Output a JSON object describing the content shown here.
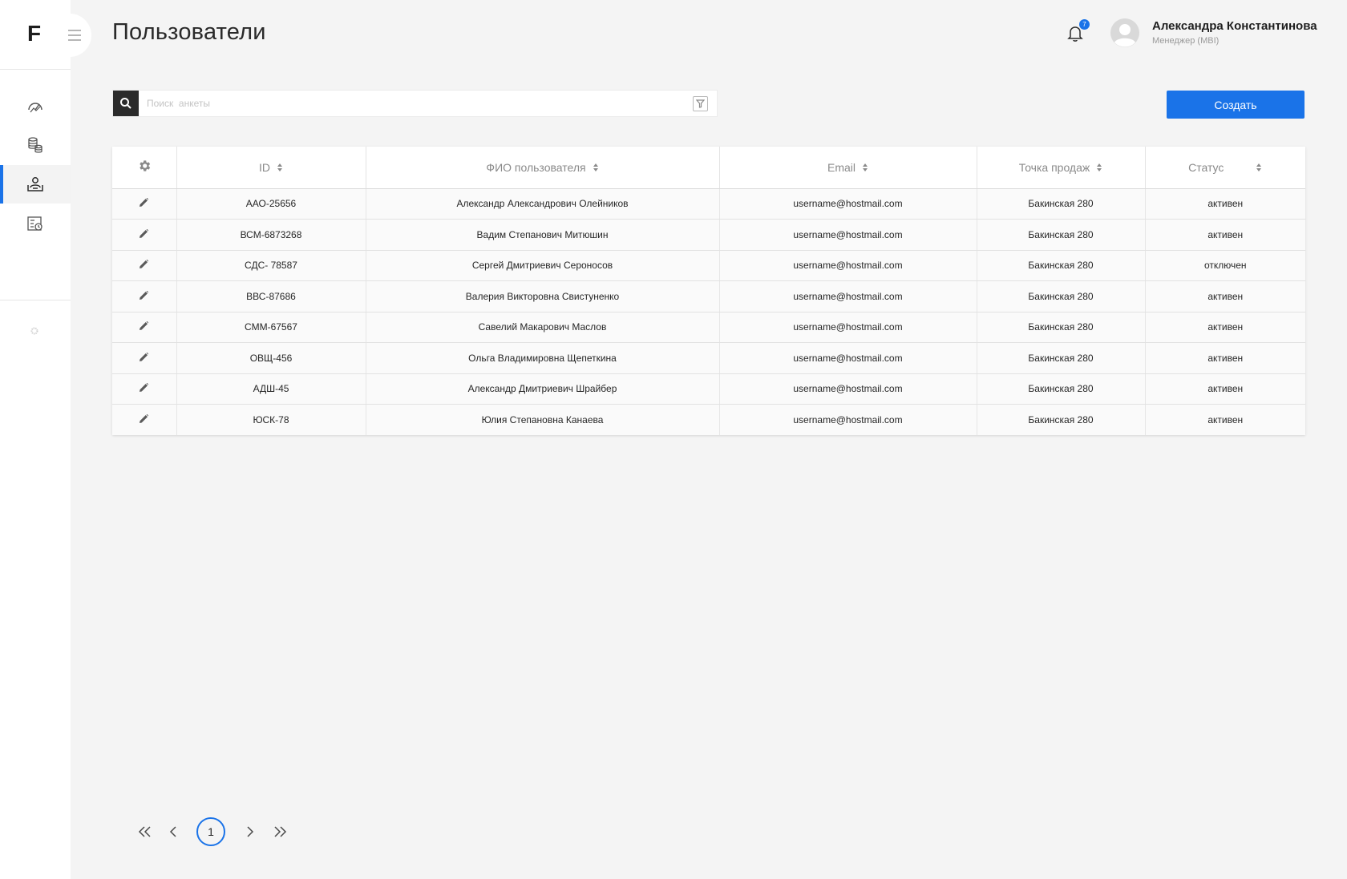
{
  "app": {
    "logo": "F"
  },
  "header": {
    "title": "Пользователи",
    "notifications_count": "7",
    "user_name": "Александра Константинова",
    "user_role": "Менеджер (МВI)"
  },
  "search": {
    "placeholder": "Поиск  анкеты"
  },
  "toolbar": {
    "create_label": "Создать"
  },
  "table": {
    "columns": [
      "ID",
      "ФИО пользователя",
      "Email",
      "Точка продаж",
      "Статус"
    ],
    "rows": [
      {
        "id": "ААО-25656",
        "name": "Александр Александрович Олейников",
        "email": "username@hostmail.com",
        "point": "Бакинская 280",
        "status": "активен"
      },
      {
        "id": "ВСМ-6873268",
        "name": "Вадим Степанович Митюшин",
        "email": "username@hostmail.com",
        "point": "Бакинская 280",
        "status": "активен"
      },
      {
        "id": "СДС- 78587",
        "name": "Сергей Дмитриевич  Сероносов",
        "email": "username@hostmail.com",
        "point": "Бакинская 280",
        "status": "отключен"
      },
      {
        "id": "ВВС-87686",
        "name": "Валерия Викторовна Свистуненко",
        "email": "username@hostmail.com",
        "point": "Бакинская 280",
        "status": "активен"
      },
      {
        "id": "СММ-67567",
        "name": "Савелий Макарович Маслов",
        "email": "username@hostmail.com",
        "point": "Бакинская 280",
        "status": "активен"
      },
      {
        "id": "ОВЩ-456",
        "name": "Ольга Владимировна Щепеткина",
        "email": "username@hostmail.com",
        "point": "Бакинская 280",
        "status": "активен"
      },
      {
        "id": "АДШ-45",
        "name": "Александр Дмитриевич Шрайбер",
        "email": "username@hostmail.com",
        "point": "Бакинская 280",
        "status": "активен"
      },
      {
        "id": "ЮСК-78",
        "name": "Юлия Степановна Канаева",
        "email": "username@hostmail.com",
        "point": "Бакинская 280",
        "status": "активен"
      }
    ]
  },
  "pagination": {
    "current_page": "1"
  },
  "colors": {
    "accent": "#1a73e8",
    "dark": "#2b2b2b"
  },
  "icons": {
    "sidebar": [
      "dashboard-icon",
      "database-icon",
      "users-icon",
      "report-icon"
    ],
    "row_action": "pencil-icon",
    "table_settings": "gear-icon"
  }
}
